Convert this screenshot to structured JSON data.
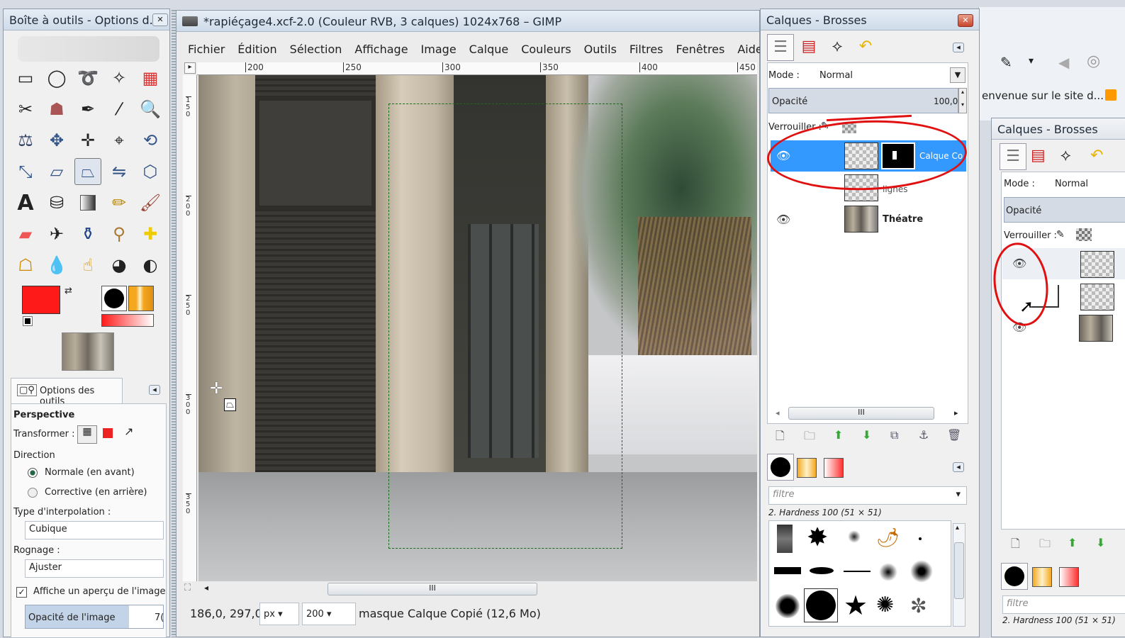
{
  "toolbox": {
    "title": "Boîte à outils - Options d...",
    "options_tab": "Options des outils",
    "tool_name": "Perspective",
    "transform_label": "Transformer :",
    "direction_label": "Direction",
    "direction_normal": "Normale (en avant)",
    "direction_corrective": "Corrective (en arrière)",
    "interp_label": "Type d'interpolation :",
    "interp_value": "Cubique",
    "clip_label": "Rognage :",
    "clip_value": "Ajuster",
    "preview_label": "Affiche un aperçu de l'image",
    "opacity_label": "Opacité de l'image",
    "opacity_value": "7("
  },
  "image_window": {
    "title": "*rapiéçage4.xcf-2.0 (Couleur RVB, 3 calques) 1024x768 – GIMP",
    "menu": [
      "Fichier",
      "Édition",
      "Sélection",
      "Affichage",
      "Image",
      "Calque",
      "Couleurs",
      "Outils",
      "Filtres",
      "Fenêtres",
      "Aide"
    ],
    "ruler_h": [
      "200",
      "250",
      "300",
      "350",
      "400",
      "450"
    ],
    "ruler_v": [
      "150",
      "200",
      "250",
      "300",
      "350"
    ],
    "coords": "186,0, 297,0",
    "unit": "px",
    "zoom": "200",
    "status": "masque Calque Copié (12,6 Mo)",
    "scroll_label": "III"
  },
  "layers_panel": {
    "title": "Calques - Brosses",
    "mode_label": "Mode :",
    "mode_value": "Normal",
    "opacity_label": "Opacité",
    "opacity_value": "100,0",
    "lock_label": "Verrouiller :",
    "layers": [
      {
        "name": "Calque Co",
        "visible": true,
        "selected": true
      },
      {
        "name": "lignes",
        "visible": false,
        "selected": false
      },
      {
        "name": "Théatre",
        "visible": true,
        "selected": false
      }
    ],
    "scroll_label": "III",
    "filter_placeholder": "filtre",
    "brush_name": "2. Hardness 100 (51 × 51)"
  },
  "second_panel": {
    "title": "Calques - Brosses",
    "mode_label": "Mode :",
    "mode_value": "Normal",
    "opacity_label": "Opacité",
    "lock_label": "Verrouiller :",
    "filter_placeholder": "filtre",
    "brush_name": "2. Hardness 100 (51 × 51)"
  },
  "browser": {
    "tab_text": "envenue sur le site d..."
  },
  "colors": {
    "fg": "#ff1a1a",
    "bg": "#ffffff",
    "selected_layer": "#3399ff",
    "annotation": "#e01010"
  }
}
